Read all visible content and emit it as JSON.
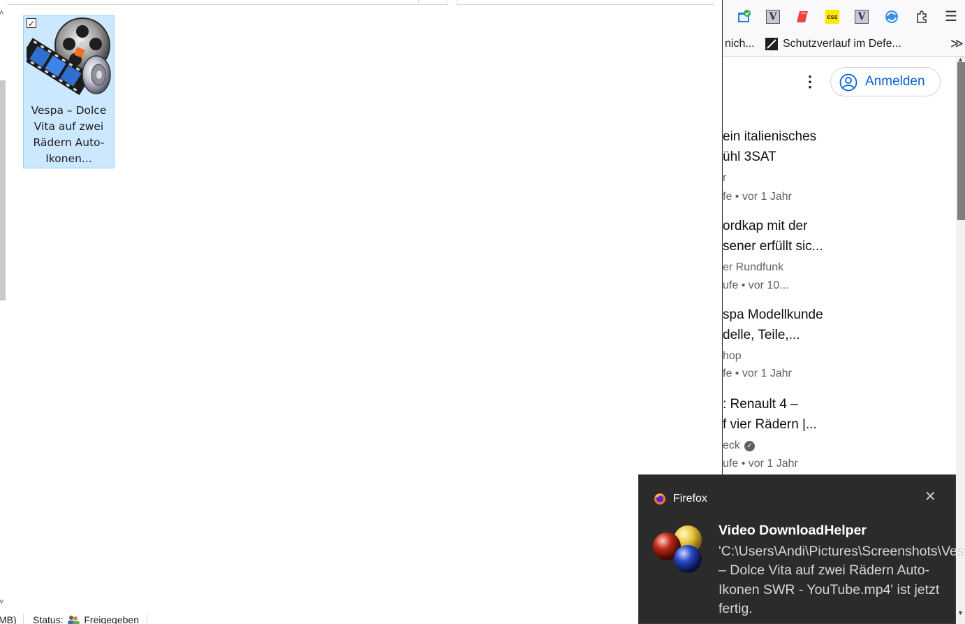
{
  "explorer": {
    "file": {
      "label": "Vespa – Dolce Vita auf zwei Rädern Auto-Ikonen...",
      "checkbox_state": "checked",
      "icon": "media-player-film-icon"
    },
    "statusbar": {
      "left_fragment": "MB)",
      "status_label": "Status:",
      "status_value": "Freigegeben",
      "status_icon": "shared-users-icon"
    }
  },
  "browser": {
    "toolbar": {
      "icons": [
        "extension-check-icon",
        "v-extension-icon",
        "eraser-extension-icon",
        "css-extension-icon",
        "v-extension-icon",
        "sync-extension-icon",
        "extensions-puzzle-icon",
        "hamburger-menu-icon"
      ],
      "css_badge": "css",
      "v_badge": "V",
      "menu_glyph": "☰"
    },
    "bookmarks": {
      "item1": "nich...",
      "item2": "Schutzverlauf im Defe...",
      "more_glyph": "≫"
    },
    "header": {
      "kebab_glyph": "⋮",
      "signin_label": "Anmelden"
    },
    "videos": [
      {
        "title_line1": "ein italienisches",
        "title_line2": "ühl 3SAT",
        "channel": "r",
        "meta": "fe  • vor 1 Jahr",
        "verified": false
      },
      {
        "title_line1": "ordkap mit der",
        "title_line2": "sener erfüllt sic...",
        "channel": "er Rundfunk",
        "meta": "ufe  • vor 10...",
        "verified": false
      },
      {
        "title_line1": "spa Modellkunde",
        "title_line2": "delle, Teile,...",
        "channel": "hop",
        "meta": "fe  • vor 1 Jahr",
        "verified": false
      },
      {
        "title_line1": ": Renault 4 –",
        "title_line2": "f vier Rädern |...",
        "channel": "eck",
        "meta": "ufe  • vor 1 Jahr",
        "verified": true
      }
    ]
  },
  "toast": {
    "app_name": "Firefox",
    "close_glyph": "✕",
    "title": "Video DownloadHelper",
    "body": "'C:\\Users\\Andi\\Pictures\\Screenshots\\Vespa – Dolce Vita auf zwei Rädern Auto-Ikonen SWR - YouTube.mp4' ist jetzt fertig.",
    "background_color": "#2b2b2b"
  },
  "colors": {
    "selection_fill": "#cce8ff",
    "selection_border": "#99d1ff",
    "link_blue": "#065fd4"
  }
}
